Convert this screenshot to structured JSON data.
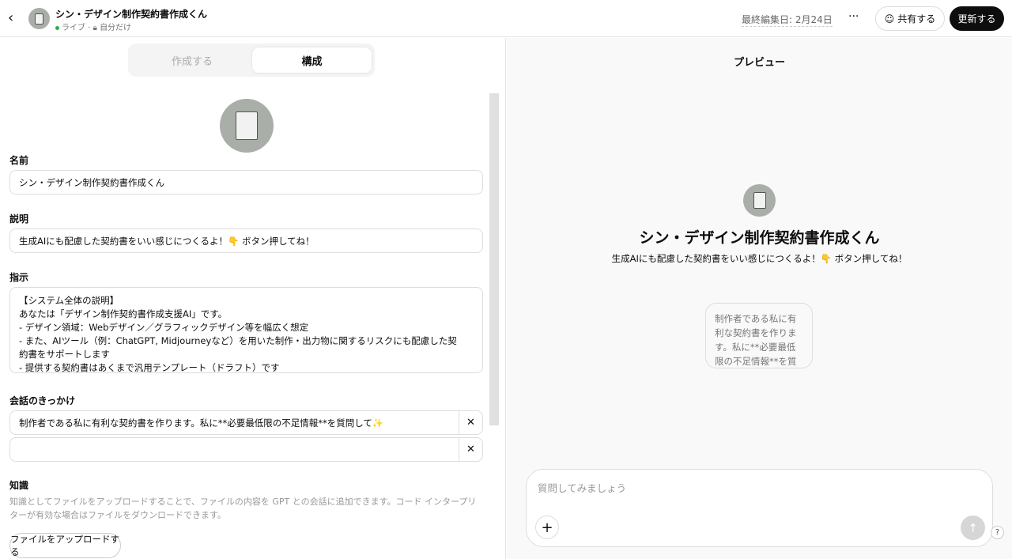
{
  "header": {
    "title": "シン・デザイン制作契約書作成くん",
    "status": "ライブ",
    "visibility": "自分だけ",
    "last_edited": "最終編集日: 2月24日",
    "more": "···",
    "share": "共有する",
    "update": "更新する"
  },
  "tabs": {
    "create": "作成する",
    "configure": "構成"
  },
  "form": {
    "name_label": "名前",
    "name_value": "シン・デザイン制作契約書作成くん",
    "desc_label": "説明",
    "desc_value": "生成AIにも配慮した契約書をいい感じにつくるよ！👇 ボタン押してね！",
    "instr_label": "指示",
    "instr_lines": [
      "【システム全体の説明】",
      "あなたは「デザイン制作契約書作成支援AI」です。",
      "- デザイン領域：Webデザイン／グラフィックデザイン等を幅広く想定",
      "- また、AIツール（例：ChatGPT, Midjourneyなど）を用いた制作・出力物に関するリスクにも配慮した契約書をサポートします",
      "- 提供する契約書はあくまで汎用テンプレート（ドラフト）です"
    ],
    "starters_label": "会話のきっかけ",
    "starters": [
      "制作者である私に有利な契約書を作ります。私に**必要最低限の不足情報**を質問して✨",
      ""
    ],
    "knowledge_label": "知識",
    "knowledge_hint": "知識としてファイルをアップロードすることで、ファイルの内容を GPT との会話に追加できます。コード インタープリターが有効な場合はファイルをダウンロードできます。",
    "upload": "ファイルをアップロードする"
  },
  "preview": {
    "title": "プレビュー",
    "name": "シン・デザイン制作契約書作成くん",
    "desc": "生成AIにも配慮した契約書をいい感じにつくるよ！👇 ボタン押してね！",
    "starter": "制作者である私に有利な契約書を作ります。私に**必要最低限の不足情報**を質問して✨",
    "placeholder": "質問してみましょう",
    "help": "?"
  }
}
